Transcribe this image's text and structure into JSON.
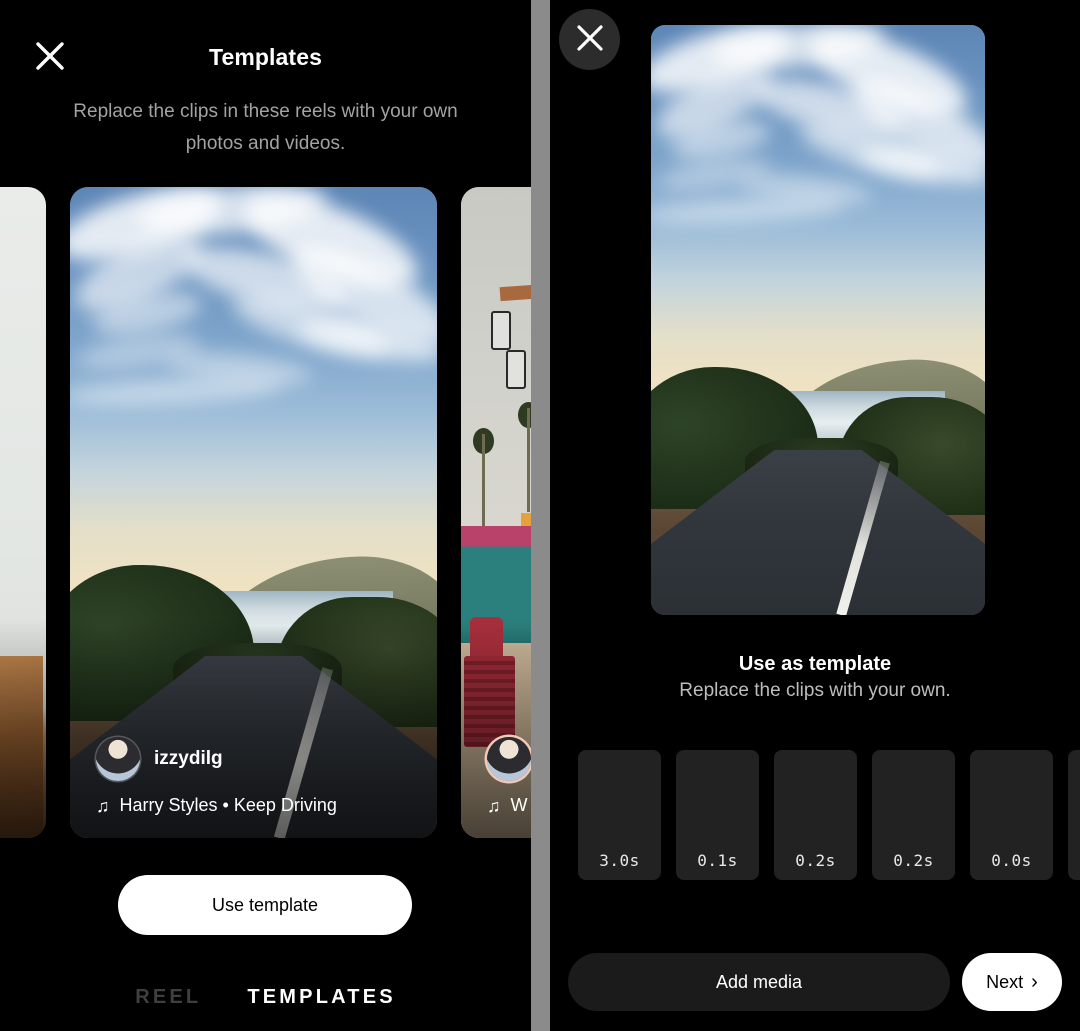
{
  "left_panel": {
    "close_icon": "close-x-icon",
    "title": "Templates",
    "subtitle": "Replace the clips in these reels with your own photos and videos.",
    "carousel": {
      "cards": [
        {
          "id": "prev",
          "artwork": "interior-scene",
          "username": "",
          "audio": ""
        },
        {
          "id": "main",
          "artwork": "coastal-road-scene",
          "username": "izzydilg",
          "music_icon": "music-note-icon",
          "audio": "Harry Styles • Keep Driving"
        },
        {
          "id": "next",
          "artwork": "boardwalk-scene",
          "username": "",
          "music_icon": "music-note-icon",
          "audio": "W"
        }
      ]
    },
    "use_template_label": "Use template",
    "tabs": [
      {
        "label": "REEL",
        "active": false
      },
      {
        "label": "TEMPLATES",
        "active": true
      }
    ]
  },
  "right_panel": {
    "close_icon": "close-x-icon",
    "preview_artwork": "coastal-road-scene",
    "title": "Use as template",
    "subtitle": "Replace the clips with your own.",
    "clips": [
      {
        "duration": "3.0s"
      },
      {
        "duration": "0.1s"
      },
      {
        "duration": "0.2s"
      },
      {
        "duration": "0.2s"
      },
      {
        "duration": "0.0s"
      },
      {
        "duration": ""
      }
    ],
    "add_media_label": "Add media",
    "next_label": "Next",
    "next_icon": "chevron-right-icon"
  },
  "colors": {
    "background": "#000000",
    "divider": "#8b8b8b",
    "accent_white": "#ffffff",
    "muted_text": "#a3a3a3",
    "tab_inactive": "#3f3f3f",
    "clip_slot": "#222222",
    "add_media_bg": "#1b1b1b"
  }
}
